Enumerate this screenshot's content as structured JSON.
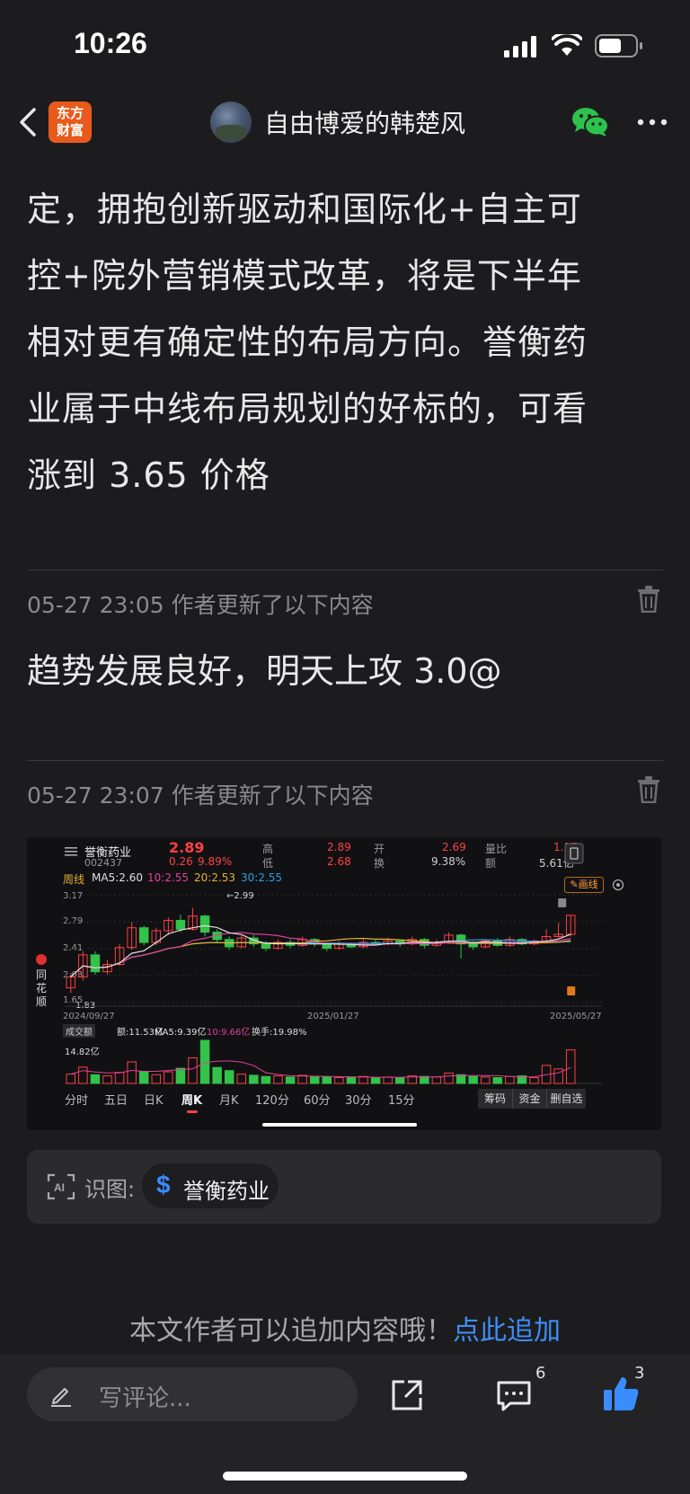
{
  "status_bar": {
    "time": "10:26"
  },
  "nav": {
    "logo_line1": "东方",
    "logo_line2": "财富",
    "author": "自由博爱的韩楚风"
  },
  "article": {
    "lines": [
      "定，拥抱创新驱动和国际化+自主可",
      "控+院外营销模式改革，将是下半年",
      "相对更有确定性的布局方向。誉衡药",
      "业属于中线布局规划的好标的，可看",
      "涨到 3.65 价格"
    ]
  },
  "updates": [
    {
      "meta": "05-27 23:05 作者更新了以下内容",
      "text": "趋势发展良好，明天上攻 3.0@"
    },
    {
      "meta": "05-27 23:07 作者更新了以下内容"
    }
  ],
  "stock_image": {
    "side_brand": [
      "同",
      "花",
      "顺"
    ],
    "name": "誉衡药业",
    "code": "002437",
    "price": "2.89",
    "change": "0.26",
    "change_pct": "9.89%",
    "high_label": "高",
    "high": "2.89",
    "low_label": "低",
    "low": "2.68",
    "open_label": "开",
    "open": "2.69",
    "turnover_label": "换",
    "turnover": "9.38%",
    "vol_ratio_label": "量比",
    "vol_ratio": "1.17",
    "amount_label": "额",
    "amount": "5.61亿",
    "period": "周线",
    "ma_legend": {
      "ma5": "MA5:2.60",
      "ma10": "10:2.55",
      "ma20": "20:2.53",
      "ma30": "30:2.55"
    },
    "draw_button": "画线",
    "y_ticks": [
      "3.17",
      "2.79",
      "2.41",
      "2.03",
      "1.65"
    ],
    "low_marker": "1.83",
    "high_marker": "←2.99",
    "dates": [
      "2024/09/27",
      "2025/01/27",
      "2025/05/27"
    ],
    "volume_legend": {
      "label": "成交额",
      "amount": "额:11.53亿",
      "ma5": "MA5:9.39亿",
      "ma10": "10:9.66亿",
      "turnover": "换手:19.98%"
    },
    "vol_tick": "14.82亿",
    "period_tabs": [
      "分时",
      "五日",
      "日K",
      "周K",
      "月K",
      "120分",
      "60分",
      "30分",
      "15分"
    ],
    "active_tab": "周K",
    "tool_buttons": [
      "筹码",
      "资金",
      "删自选"
    ],
    "colors": {
      "up": "#ff4040",
      "down": "#33c24a",
      "ma5": "#e0e0e0",
      "ma10": "#e0409a",
      "ma20": "#e8b030",
      "ma30": "#2aa0e0"
    }
  },
  "recognize": {
    "label": "识图:",
    "stock": "誉衡药业"
  },
  "append": {
    "prefix": "本文作者可以追加内容哦！",
    "link": "点此追加"
  },
  "bottom_bar": {
    "comment_placeholder": "写评论...",
    "comment_count": "6",
    "like_count": "3"
  },
  "chart_data": {
    "type": "candlestick",
    "title": "誉衡药业 周K",
    "x_range": [
      "2024/09/27",
      "2025/05/27"
    ],
    "ylim": [
      1.65,
      3.17
    ],
    "candles": [
      {
        "o": 1.9,
        "c": 2.05,
        "h": 2.1,
        "l": 1.83,
        "v": 3.2
      },
      {
        "o": 2.05,
        "c": 2.35,
        "h": 2.4,
        "l": 2.0,
        "v": 5.6
      },
      {
        "o": 2.35,
        "c": 2.12,
        "h": 2.4,
        "l": 2.08,
        "v": 3.0
      },
      {
        "o": 2.12,
        "c": 2.22,
        "h": 2.28,
        "l": 2.08,
        "v": 2.6
      },
      {
        "o": 2.22,
        "c": 2.45,
        "h": 2.5,
        "l": 2.2,
        "v": 3.8
      },
      {
        "o": 2.45,
        "c": 2.72,
        "h": 2.8,
        "l": 2.42,
        "v": 7.4
      },
      {
        "o": 2.72,
        "c": 2.52,
        "h": 2.75,
        "l": 2.48,
        "v": 4.1
      },
      {
        "o": 2.52,
        "c": 2.68,
        "h": 2.72,
        "l": 2.48,
        "v": 3.0
      },
      {
        "o": 2.68,
        "c": 2.82,
        "h": 2.86,
        "l": 2.62,
        "v": 4.0
      },
      {
        "o": 2.82,
        "c": 2.7,
        "h": 2.9,
        "l": 2.66,
        "v": 5.2
      },
      {
        "o": 2.7,
        "c": 2.88,
        "h": 2.99,
        "l": 2.68,
        "v": 8.8
      },
      {
        "o": 2.88,
        "c": 2.66,
        "h": 2.9,
        "l": 2.6,
        "v": 14.82
      },
      {
        "o": 2.66,
        "c": 2.56,
        "h": 2.7,
        "l": 2.52,
        "v": 5.5
      },
      {
        "o": 2.56,
        "c": 2.46,
        "h": 2.6,
        "l": 2.42,
        "v": 4.4
      },
      {
        "o": 2.46,
        "c": 2.58,
        "h": 2.62,
        "l": 2.44,
        "v": 3.2
      },
      {
        "o": 2.58,
        "c": 2.5,
        "h": 2.62,
        "l": 2.46,
        "v": 2.8
      },
      {
        "o": 2.5,
        "c": 2.44,
        "h": 2.54,
        "l": 2.4,
        "v": 2.4
      },
      {
        "o": 2.44,
        "c": 2.52,
        "h": 2.56,
        "l": 2.42,
        "v": 2.6
      },
      {
        "o": 2.52,
        "c": 2.48,
        "h": 2.56,
        "l": 2.44,
        "v": 2.2
      },
      {
        "o": 2.48,
        "c": 2.56,
        "h": 2.6,
        "l": 2.46,
        "v": 2.8
      },
      {
        "o": 2.56,
        "c": 2.5,
        "h": 2.58,
        "l": 2.46,
        "v": 2.4
      },
      {
        "o": 2.5,
        "c": 2.44,
        "h": 2.52,
        "l": 2.4,
        "v": 2.2
      },
      {
        "o": 2.44,
        "c": 2.5,
        "h": 2.54,
        "l": 2.42,
        "v": 2.0
      },
      {
        "o": 2.5,
        "c": 2.46,
        "h": 2.52,
        "l": 2.44,
        "v": 2.0
      },
      {
        "o": 2.46,
        "c": 2.52,
        "h": 2.56,
        "l": 2.44,
        "v": 2.4
      },
      {
        "o": 2.52,
        "c": 2.5,
        "h": 2.56,
        "l": 2.48,
        "v": 2.0
      },
      {
        "o": 2.5,
        "c": 2.54,
        "h": 2.58,
        "l": 2.48,
        "v": 2.2
      },
      {
        "o": 2.54,
        "c": 2.5,
        "h": 2.56,
        "l": 2.46,
        "v": 2.0
      },
      {
        "o": 2.5,
        "c": 2.56,
        "h": 2.6,
        "l": 2.48,
        "v": 2.6
      },
      {
        "o": 2.56,
        "c": 2.48,
        "h": 2.58,
        "l": 2.44,
        "v": 2.4
      },
      {
        "o": 2.48,
        "c": 2.52,
        "h": 2.56,
        "l": 2.46,
        "v": 2.2
      },
      {
        "o": 2.52,
        "c": 2.62,
        "h": 2.66,
        "l": 2.5,
        "v": 3.6
      },
      {
        "o": 2.62,
        "c": 2.5,
        "h": 2.64,
        "l": 2.3,
        "v": 3.0
      },
      {
        "o": 2.5,
        "c": 2.46,
        "h": 2.54,
        "l": 2.42,
        "v": 2.4
      },
      {
        "o": 2.46,
        "c": 2.54,
        "h": 2.56,
        "l": 2.44,
        "v": 2.2
      },
      {
        "o": 2.54,
        "c": 2.48,
        "h": 2.58,
        "l": 2.46,
        "v": 2.0
      },
      {
        "o": 2.48,
        "c": 2.56,
        "h": 2.6,
        "l": 2.46,
        "v": 2.4
      },
      {
        "o": 2.56,
        "c": 2.5,
        "h": 2.58,
        "l": 2.48,
        "v": 2.6
      },
      {
        "o": 2.5,
        "c": 2.54,
        "h": 2.56,
        "l": 2.48,
        "v": 2.0
      },
      {
        "o": 2.54,
        "c": 2.6,
        "h": 2.7,
        "l": 2.52,
        "v": 6.2
      },
      {
        "o": 2.6,
        "c": 2.63,
        "h": 2.79,
        "l": 2.58,
        "v": 5.0
      },
      {
        "o": 2.63,
        "c": 2.89,
        "h": 2.89,
        "l": 2.6,
        "v": 11.53
      }
    ]
  }
}
